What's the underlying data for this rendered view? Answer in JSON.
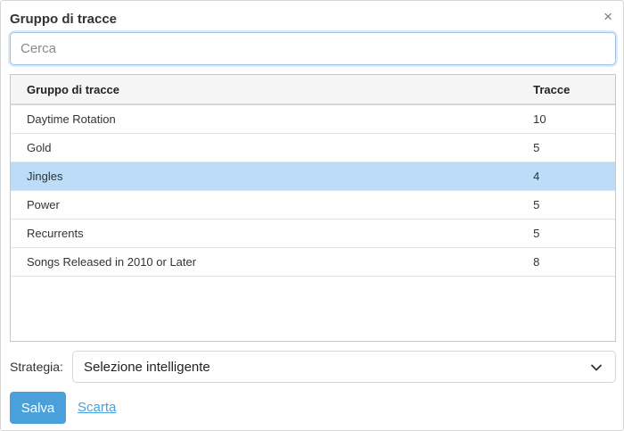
{
  "dialog": {
    "title": "Gruppo di tracce",
    "close_glyph": "×"
  },
  "search": {
    "placeholder": "Cerca",
    "value": ""
  },
  "table": {
    "headers": {
      "name": "Gruppo di tracce",
      "count": "Tracce"
    },
    "rows": [
      {
        "name": "Daytime Rotation",
        "count": "10",
        "selected": false
      },
      {
        "name": "Gold",
        "count": "5",
        "selected": false
      },
      {
        "name": "Jingles",
        "count": "4",
        "selected": true
      },
      {
        "name": "Power",
        "count": "5",
        "selected": false
      },
      {
        "name": "Recurrents",
        "count": "5",
        "selected": false
      },
      {
        "name": "Songs Released in 2010 or Later",
        "count": "8",
        "selected": false
      }
    ]
  },
  "strategy": {
    "label": "Strategia:",
    "selected": "Selezione intelligente",
    "icon": "chevron-down-icon"
  },
  "actions": {
    "save_label": "Salva",
    "discard_label": "Scarta"
  },
  "colors": {
    "accent": "#4aa0db",
    "selected_row": "#bcdcf7"
  }
}
